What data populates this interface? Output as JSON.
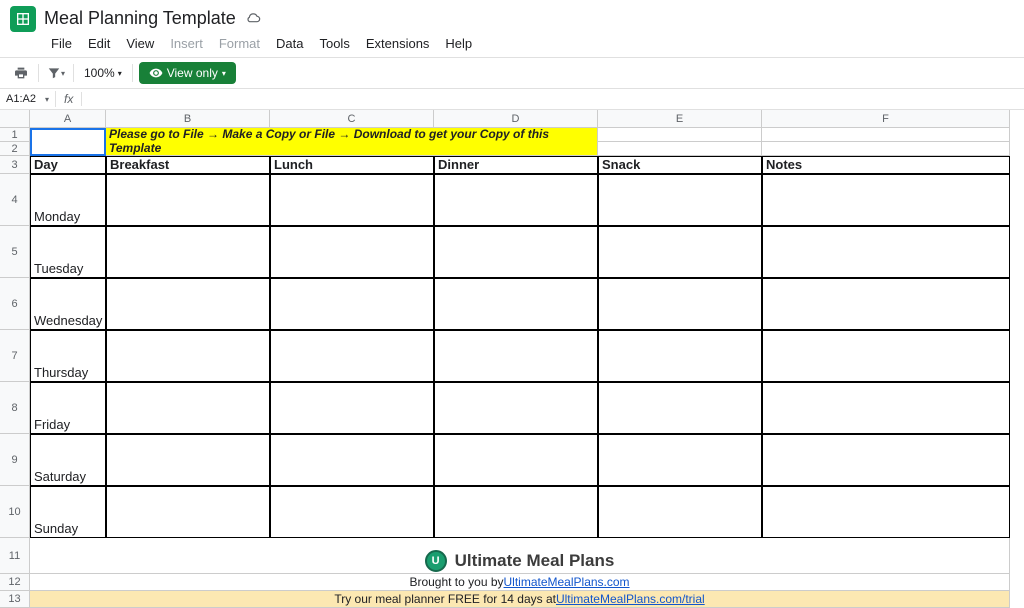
{
  "doc": {
    "title": "Meal Planning Template"
  },
  "menu": {
    "file": "File",
    "edit": "Edit",
    "view": "View",
    "insert": "Insert",
    "format": "Format",
    "data": "Data",
    "tools": "Tools",
    "extensions": "Extensions",
    "help": "Help"
  },
  "toolbar": {
    "zoom": "100%",
    "view_only": "View only"
  },
  "namebox": {
    "ref": "A1:A2",
    "fx": "fx"
  },
  "columns": [
    "A",
    "B",
    "C",
    "D",
    "E",
    "F"
  ],
  "rows": [
    "1",
    "2",
    "3",
    "4",
    "5",
    "6",
    "7",
    "8",
    "9",
    "10",
    "11",
    "12",
    "13"
  ],
  "instruction": "Please go to File → Make a Copy or File → Download to get your Copy of this Template",
  "headers": {
    "day": "Day",
    "breakfast": "Breakfast",
    "lunch": "Lunch",
    "dinner": "Dinner",
    "snack": "Snack",
    "notes": "Notes"
  },
  "days": [
    "Monday",
    "Tuesday",
    "Wednesday",
    "Thursday",
    "Friday",
    "Saturday",
    "Sunday"
  ],
  "brand": {
    "name": "Ultimate Meal Plans",
    "brought": "Brought to you by ",
    "link": "UltimateMealPlans.com",
    "trial_pre": "Try our meal planner FREE for 14 days at ",
    "trial_link": "UltimateMealPlans.com/trial"
  }
}
